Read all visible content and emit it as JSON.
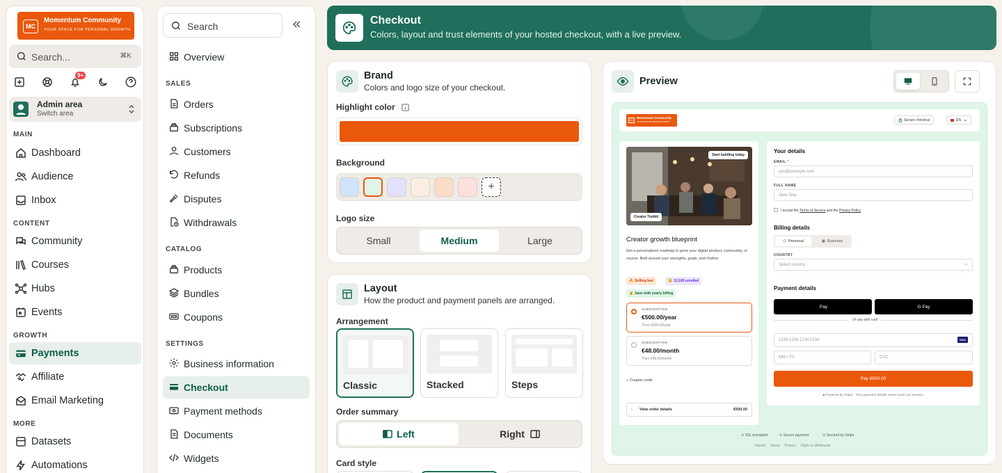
{
  "brand": {
    "initials": "MC",
    "name": "Momentum Community",
    "tagline": "YOUR SPACE FOR PERSONAL GROWTH"
  },
  "sidebar": {
    "search_placeholder": "Search...",
    "search_shortcut": "⌘K",
    "notification_count": "9+",
    "area": {
      "name": "Admin area",
      "sub": "Switch area"
    },
    "sections": [
      {
        "title": "MAIN",
        "items": [
          "Dashboard",
          "Audience",
          "Inbox"
        ]
      },
      {
        "title": "CONTENT",
        "items": [
          "Community",
          "Courses",
          "Hubs",
          "Events"
        ]
      },
      {
        "title": "GROWTH",
        "items": [
          "Payments",
          "Affiliate",
          "Email Marketing"
        ]
      },
      {
        "title": "MORE",
        "items": [
          "Datasets",
          "Automations"
        ]
      }
    ],
    "active": "Payments"
  },
  "subnav": {
    "search_placeholder": "Search",
    "overview": "Overview",
    "sections": [
      {
        "title": "SALES",
        "items": [
          "Orders",
          "Subscriptions",
          "Customers",
          "Refunds",
          "Disputes",
          "Withdrawals"
        ]
      },
      {
        "title": "CATALOG",
        "items": [
          "Products",
          "Bundles",
          "Coupons"
        ]
      },
      {
        "title": "SETTINGS",
        "items": [
          "Business information",
          "Checkout",
          "Payment methods",
          "Documents",
          "Widgets"
        ]
      }
    ],
    "active": "Checkout"
  },
  "header": {
    "title": "Checkout",
    "subtitle": "Colors, layout and trust elements of your hosted checkout, with a live preview."
  },
  "brand_card": {
    "title": "Brand",
    "subtitle": "Colors and logo size of your checkout.",
    "highlight_label": "Highlight color",
    "highlight_color": "#ea580c",
    "background_label": "Background",
    "background_swatches": [
      "#cfe3fa",
      "#dff5e8",
      "#e3e0fb",
      "#fbeee0",
      "#fbdcc6",
      "#fbe0dc"
    ],
    "logo_size_label": "Logo size",
    "logo_sizes": [
      "Small",
      "Medium",
      "Large"
    ],
    "logo_size_selected": "Medium"
  },
  "layout_card": {
    "title": "Layout",
    "subtitle": "How the product and payment panels are arranged.",
    "arrangement_label": "Arrangement",
    "arrangements": [
      "Classic",
      "Stacked",
      "Steps"
    ],
    "arrangement_selected": "Classic",
    "order_summary_label": "Order summary",
    "order_summary_options": [
      "Left",
      "Right"
    ],
    "order_summary_selected": "Left",
    "card_style_label": "Card style"
  },
  "preview": {
    "title": "Preview",
    "topbar": {
      "logo_name": "Momentum Community",
      "logo_tagline": "YOUR SPACE FOR PERSONAL GROWTH",
      "secure": "Secure checkout",
      "lang": "EN"
    },
    "product": {
      "badge": "Start building today",
      "photo_tag": "Creator Toolkit",
      "title": "Creator growth blueprint",
      "description": "Get a personalized roadmap to grow your digital product, community, or course. Built around your strengths, goals, and rhythm.",
      "chips": [
        "Selling fast",
        "12,165 enrolled",
        "Save with yearly billing"
      ],
      "plans": [
        {
          "kind": "SUBSCRIPTION",
          "price": "€500.00/year",
          "note": "Then €500.00/year"
        },
        {
          "kind": "SUBSCRIPTION",
          "price": "€48.00/month",
          "note": "Then €48.00/month"
        }
      ],
      "coupon": "Coupon code",
      "order_details": "View order details",
      "order_total": "€500.00"
    },
    "form": {
      "details_title": "Your details",
      "email_label": "EMAIL",
      "email_placeholder": "you@example.com",
      "name_label": "FULL NAME",
      "name_placeholder": "Jane Doe",
      "terms_pre": "I accept the",
      "terms_link": "Terms of Service",
      "terms_mid": "and the",
      "privacy_link": "Privacy Policy",
      "billing_title": "Billing details",
      "billing_tabs": [
        "Personal",
        "Business"
      ],
      "country_label": "COUNTRY",
      "country_placeholder": "Select country...",
      "payment_title": "Payment details",
      "apple_pay": "Pay",
      "google_pay": "G Pay",
      "or_card": "Or pay with card",
      "card_placeholder": "1234 1234 1234 1234",
      "card_brand": "VISA",
      "exp_placeholder": "MM / YY",
      "cvc_placeholder": "CVC",
      "pay_button": "Pay €500.00",
      "powered": "Powered by Stripe · Your payment details never touch our servers."
    },
    "trust": [
      "SSL encrypted",
      "Secure payment",
      "Secured by Stripe"
    ],
    "footer_links": [
      "Imprint",
      "Terms",
      "Privacy",
      "Right of withdrawal"
    ]
  }
}
